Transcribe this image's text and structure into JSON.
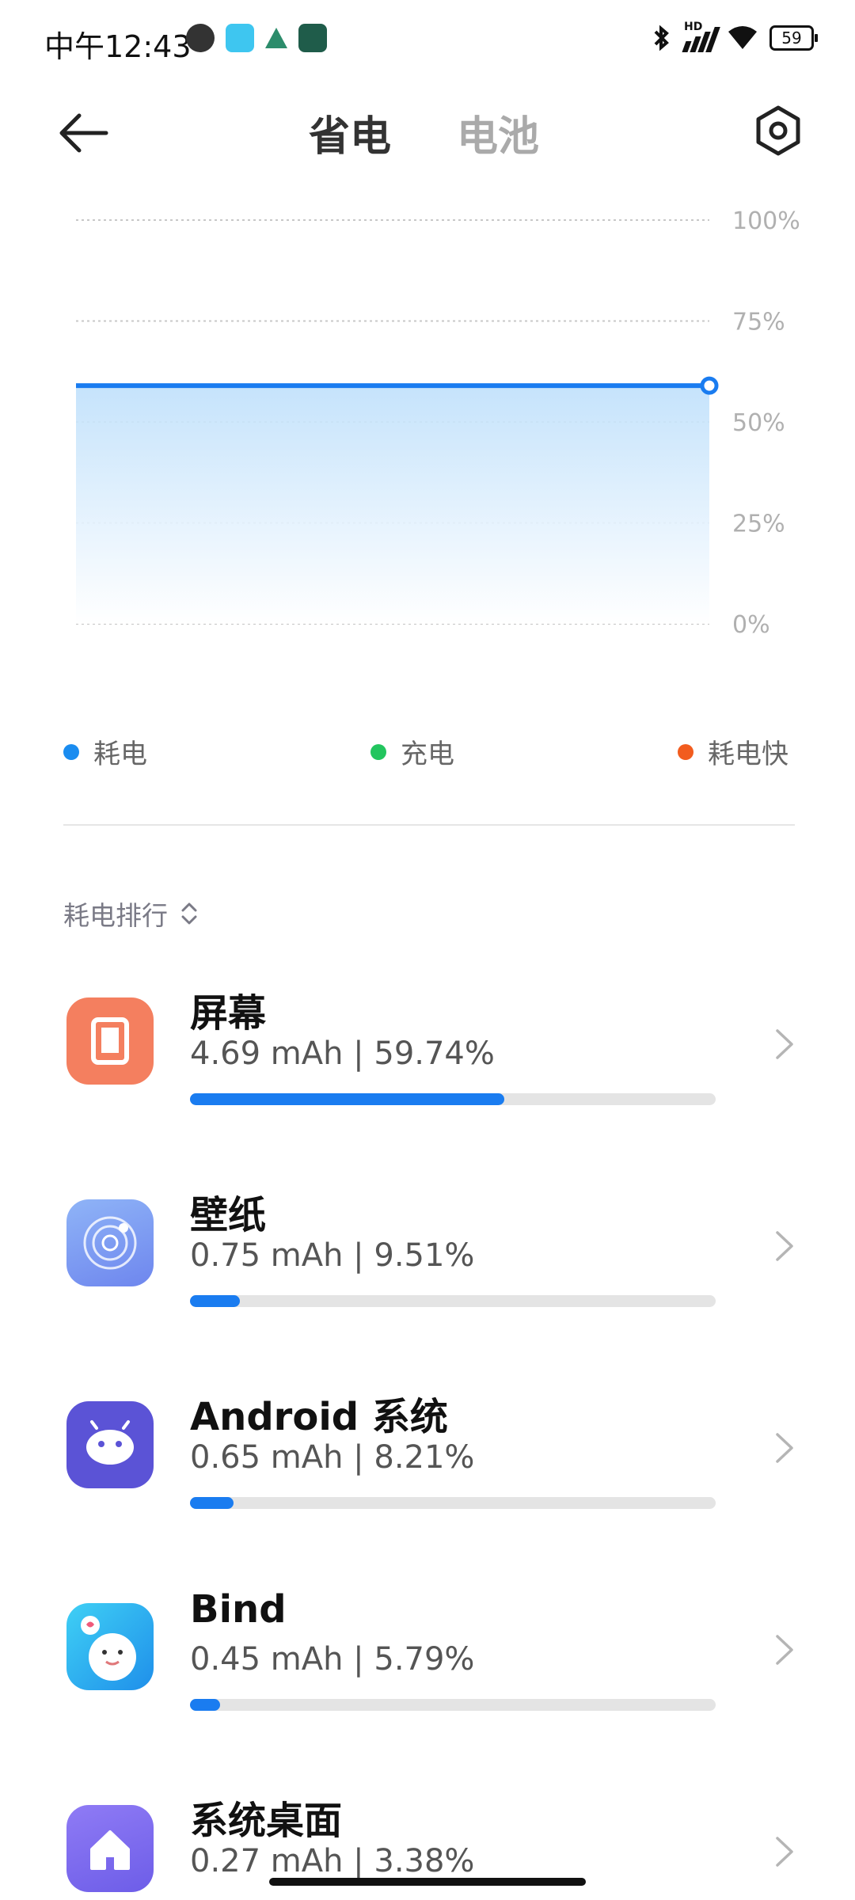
{
  "status_bar": {
    "time": "中午12:43",
    "network_label": "HD",
    "battery_level": "59"
  },
  "header": {
    "tab_active": "省电",
    "tab_inactive": "电池"
  },
  "chart_data": {
    "type": "area",
    "title": "",
    "y_ticks": [
      "100%",
      "75%",
      "50%",
      "25%",
      "0%"
    ],
    "ylim": [
      0,
      100
    ],
    "series": [
      {
        "name": "耗电",
        "values": [
          59,
          59
        ]
      }
    ],
    "grid": true,
    "legend_position": "bottom",
    "line_color": "#1a7cf0"
  },
  "legend": [
    {
      "label": "耗电",
      "color": "#1a8cf0"
    },
    {
      "label": "充电",
      "color": "#22c55e"
    },
    {
      "label": "耗电快",
      "color": "#f25c1e"
    }
  ],
  "section": {
    "title": "耗电排行"
  },
  "apps": [
    {
      "name": "屏幕",
      "usage": "4.69 mAh | 59.74%",
      "percent": 59.74,
      "icon": "screen-icon",
      "icon_color": "#f47f5f"
    },
    {
      "name": "壁纸",
      "usage": "0.75 mAh | 9.51%",
      "percent": 9.51,
      "icon": "wallpaper-icon",
      "icon_color": "#7a9cf4"
    },
    {
      "name": "Android 系统",
      "usage": "0.65 mAh | 8.21%",
      "percent": 8.21,
      "icon": "android-icon",
      "icon_color": "#5b53d6"
    },
    {
      "name": "Bind",
      "usage": "0.45 mAh | 5.79%",
      "percent": 5.79,
      "icon": "bind-icon",
      "icon_color": "#31b8f0"
    },
    {
      "name": "系统桌面",
      "usage": "0.27 mAh | 3.38%",
      "percent": 3.38,
      "icon": "home-icon",
      "icon_color": "#7e6cf0"
    }
  ]
}
